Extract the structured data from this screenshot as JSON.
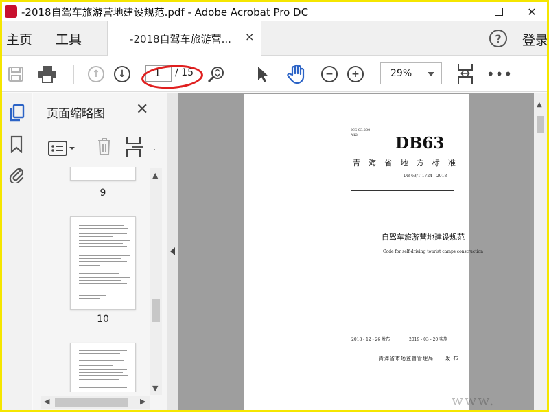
{
  "window": {
    "title": "-2018自驾车旅游营地建设规范.pdf - Adobe Acrobat Pro DC",
    "close_glyph": "✕"
  },
  "nav": {
    "home_label": "主页",
    "tools_label": "工具",
    "tab_label": "-2018自驾车旅游营...",
    "tab_close": "×",
    "help_glyph": "?",
    "login_label": "登录"
  },
  "toolbar": {
    "current_page": "1",
    "total_pages": "/ 15",
    "zoom_level": "29%",
    "more_glyph": "•••"
  },
  "thumbnail_panel": {
    "title": "页面缩略图",
    "close_glyph": "✕",
    "pages": [
      {
        "label": "9"
      },
      {
        "label": "10"
      },
      {
        "label": ""
      }
    ]
  },
  "document": {
    "ics_line": "ICS 03.200",
    "class_line": "A12",
    "code": "DB63",
    "standard_chars": [
      "青",
      "海",
      "省",
      "地",
      "方",
      "标",
      "准"
    ],
    "standard_number": "DB 63/T 1724—2018",
    "title_cn": "自驾车旅游营地建设规范",
    "title_en": "Code for self-driving tourist camps construction",
    "publish_date": "2018 - 12 - 26 发布",
    "effective_date": "2019 - 03 - 20 实施",
    "issuer": "青海省市场监督管理局",
    "issued_word": "发 布"
  },
  "watermark": {
    "text": "www."
  },
  "colors": {
    "frame_border": "#f5e600",
    "annotation_red": "#e01f1f",
    "accent_blue": "#2b63c6"
  }
}
